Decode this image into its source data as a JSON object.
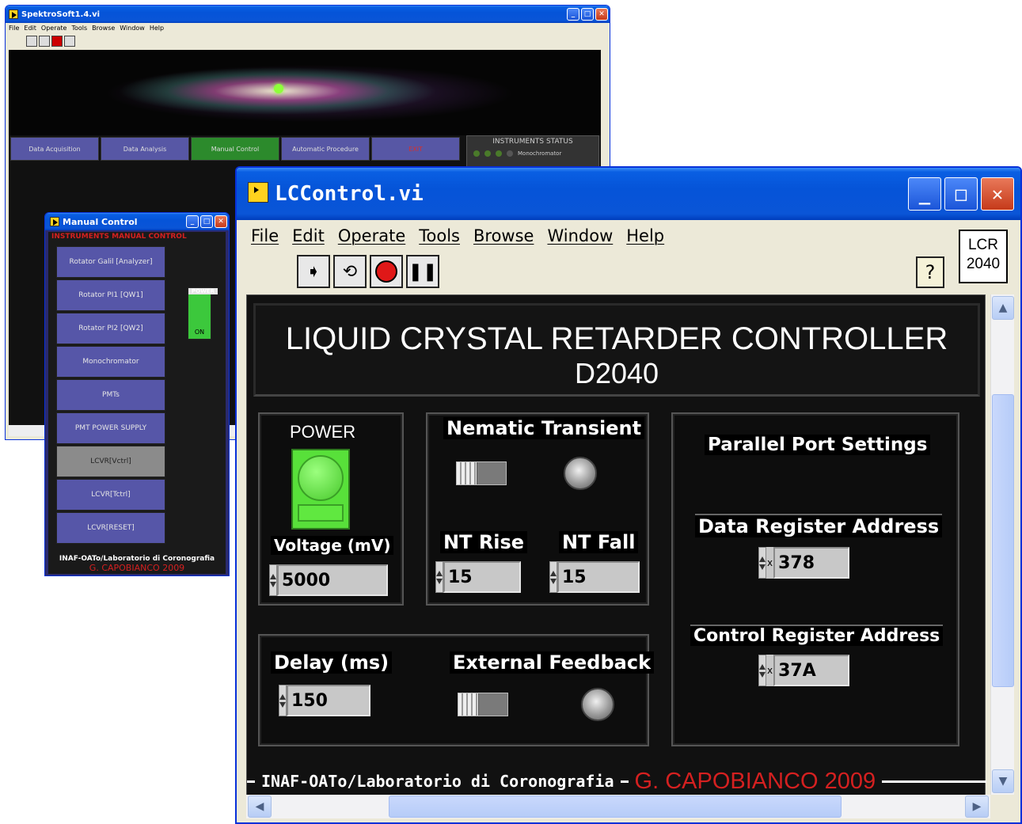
{
  "win1": {
    "title": "SpektroSoft1.4.vi",
    "menu": [
      "File",
      "Edit",
      "Operate",
      "Tools",
      "Browse",
      "Window",
      "Help"
    ],
    "nav": [
      "Data Acquisition",
      "Data Analysis",
      "Manual Control",
      "Automatic Procedure",
      "EXIT"
    ],
    "status_title": "INSTRUMENTS STATUS",
    "status_label": "Monochromator"
  },
  "win2": {
    "title": "Manual Control",
    "header": "INSTRUMENTS MANUAL CONTROL",
    "buttons": [
      "Rotator Galil [Analyzer]",
      "Rotator PI1 [QW1]",
      "Rotator PI2 [QW2]",
      "Monochromator",
      "PMTs",
      "PMT POWER SUPPLY",
      "LCVR[Vctrl]",
      "LCVR[Tctrl]",
      "LCVR[RESET]"
    ],
    "power_label": "POWER",
    "power_state": "ON",
    "footer": "INAF-OATo/Laboratorio di Coronografia",
    "author": "G. CAPOBIANCO 2009"
  },
  "win3": {
    "title": "LCControl.vi",
    "menu": [
      "File",
      "Edit",
      "Operate",
      "Tools",
      "Browse",
      "Window",
      "Help"
    ],
    "icon_text": [
      "LCR",
      "2040"
    ],
    "help_glyph": "?",
    "header_line1": "LIQUID CRYSTAL RETARDER CONTROLLER",
    "header_line2": "D2040",
    "power_label": "POWER",
    "voltage_label": "Voltage (mV)",
    "voltage_value": "5000",
    "nt_label": "Nematic Transient",
    "nt_rise_label": "NT Rise",
    "nt_rise_value": "15",
    "nt_fall_label": "NT Fall",
    "nt_fall_value": "15",
    "delay_label": "Delay (ms)",
    "delay_value": "150",
    "ext_label": "External Feedback",
    "pp_title": "Parallel Port Settings",
    "data_reg_label": "Data Register Address",
    "data_reg_value": "378",
    "ctrl_reg_label": "Control Register Address",
    "ctrl_reg_value": "37A",
    "hex_prefix": "x",
    "footer": "INAF-OATo/Laboratorio di Coronografia",
    "author": "G. CAPOBIANCO 2009"
  }
}
